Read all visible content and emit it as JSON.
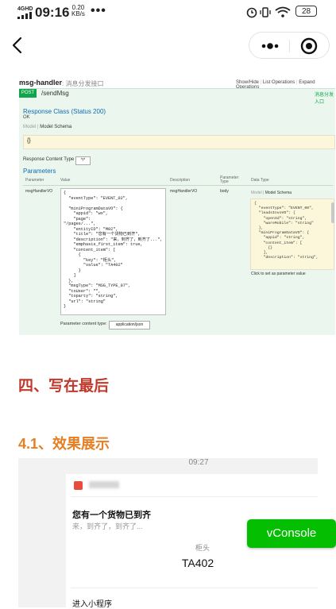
{
  "status_bar": {
    "signal": "4GHD",
    "time": "09:16",
    "speed_value": "0.20",
    "speed_unit": "KB/s",
    "more": "•••",
    "battery": "28"
  },
  "swagger": {
    "title": "msg-handler",
    "subtitle": ": 消息分发接口",
    "links": [
      "Show/Hide",
      "List Operations",
      "Expand Operations"
    ],
    "method": "POST",
    "path": "/sendMsg",
    "path_note": "消息分发入口",
    "response_class": "Response Class (Status 200)",
    "response_ok": "OK",
    "model_tab": "Model",
    "model_schema_tab": "Model Schema",
    "model_value": "{}",
    "response_content_type_label": "Response Content Type",
    "response_content_type_value": "*/*",
    "parameters_title": "Parameters",
    "columns": [
      "Parameter",
      "Value",
      "Description",
      "Parameter Type",
      "Data Type"
    ],
    "param_name": "msgHandlerVO",
    "param_value": "{\n  \"eventType\": \"EVENT_02\",\n\n  \"miniProgramDataVO\": {\n    \"appid\": \"wx\",\n    \"page\":\n\"/pages/...\",\n    \"entityID\": \"M02\",\n    \"title\": \"您有一个货物已到齐\",\n    \"description\": \"来，到齐了，到齐了...\",\n    \"emphasis_first_item\": true,\n    \"content_item\": [\n      {\n        \"key\": \"柜头\",\n        \"value\": \"TA402\"\n      }\n    ]\n  },\n  \"msgType\": \"MSG_TYPE_07\",\n  \"toUser\": \"\",\n  \"toparty\": \"string\",\n  \"url\": \"string\"\n}",
    "param_description": "msgHandlerVO",
    "param_type": "body",
    "schema_model": "Model",
    "schema_model_schema": "Model Schema",
    "schema_text": "{\n  \"eventType\": \"EVENT_00\",\n  \"leadsInvoVO\": {\n    \"openId\": \"string\",\n    \"wareMobile\": \"string\"\n  },\n  \"miniProgramDataVO\": {\n    \"appid\": \"string\",\n    \"content_item\": [\n      {}\n    ],\n    \"description\": \"string\",",
    "click_to_set": "Click to set as parameter value",
    "param_content_type_label": "Parameter content type:",
    "param_content_type_value": "application/json"
  },
  "article": {
    "heading_4": "四、写在最后",
    "heading_41": "4.1、效果展示"
  },
  "preview": {
    "time": "09:27",
    "title": "您有一个货物已到齐",
    "description": "来，到齐了，到齐了...",
    "key": "柜头",
    "value": "TA402",
    "link": "进入小程序"
  },
  "vconsole": {
    "label": "vConsole",
    "color": "#04be02"
  }
}
